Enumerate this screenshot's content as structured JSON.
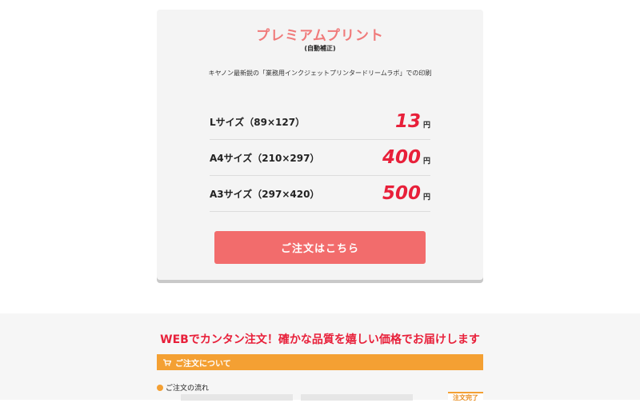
{
  "card": {
    "title": "プレミアムプリント",
    "subtitle": "(自動補正)",
    "description": "キヤノン最新鋭の「業務用インクジェットプリンタードリームラボ」での印刷",
    "prices": [
      {
        "label": "Lサイズ（89×127）",
        "price": "13",
        "unit": "円"
      },
      {
        "label": "A4サイズ（210×297）",
        "price": "400",
        "unit": "円"
      },
      {
        "label": "A3サイズ（297×420）",
        "price": "500",
        "unit": "円"
      }
    ],
    "order_button": "ご注文はこちら"
  },
  "lower": {
    "headline": "WEBでカンタン注文！確かな品質を嬉しい価格でお届けします",
    "section_bar": "ご注文について",
    "flow_label": "ご注文の流れ",
    "badge": "注文完了"
  },
  "colors": {
    "accent_red": "#e8203a",
    "button": "#f26c6c",
    "orange": "#f4a033"
  },
  "icons": [
    "cart-icon",
    "dot-icon"
  ]
}
